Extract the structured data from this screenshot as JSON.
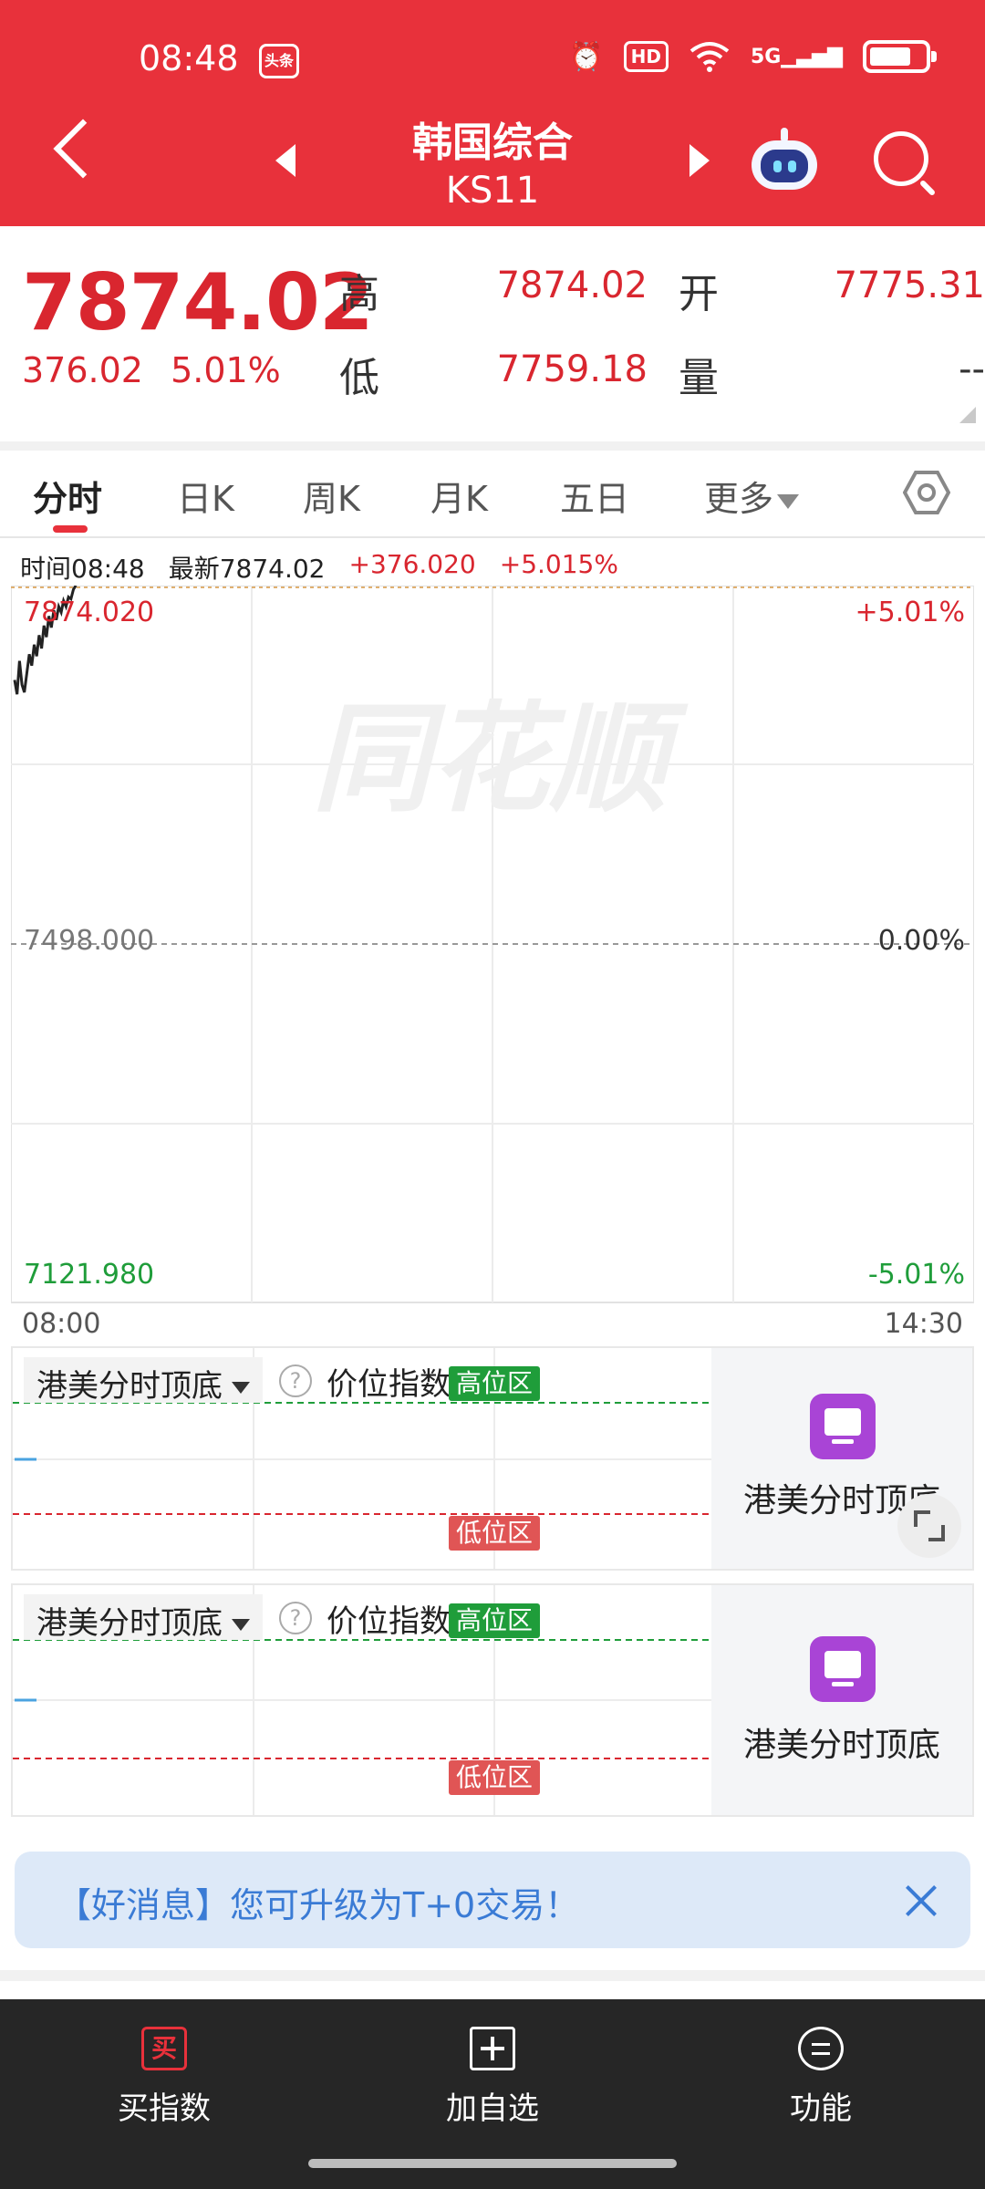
{
  "status_bar": {
    "time": "08:48",
    "badge": "头条",
    "hd": "HD",
    "network": "5G"
  },
  "nav": {
    "title": "韩国综合",
    "code": "KS11"
  },
  "quote": {
    "price": "7874.02",
    "change": "376.02",
    "change_pct": "5.01%",
    "high_label": "高",
    "high_value": "7874.02",
    "open_label": "开",
    "open_value": "7775.31",
    "low_label": "低",
    "low_value": "7759.18",
    "volume_label": "量",
    "volume_value": "--"
  },
  "tabs": [
    {
      "label": "分时"
    },
    {
      "label": "日K"
    },
    {
      "label": "周K"
    },
    {
      "label": "月K"
    },
    {
      "label": "五日"
    },
    {
      "label": "更多"
    }
  ],
  "info_line": {
    "time": "时间08:48",
    "latest": "最新7874.02",
    "change": "+376.020",
    "change_pct": "+5.015%"
  },
  "chart_data": {
    "type": "line",
    "y_top_label": "7874.020",
    "y_mid_label": "7498.000",
    "y_bottom_label": "7121.980",
    "pct_top_label": "+5.01%",
    "pct_mid_label": "0.00%",
    "pct_bottom_label": "-5.01%",
    "x_start_label": "08:00",
    "x_end_label": "14:30",
    "ylim": [
      7121.98,
      7874.02
    ],
    "watermark": "同花顺",
    "series": [
      {
        "x": [
          "08:00",
          "08:01",
          "08:02",
          "08:03",
          "08:04",
          "08:05",
          "08:06",
          "08:07",
          "08:08",
          "08:09",
          "08:10",
          "08:11",
          "08:12",
          "08:13",
          "08:14",
          "08:15",
          "08:16",
          "08:17",
          "08:18",
          "08:19",
          "08:20",
          "08:21",
          "08:22",
          "08:23",
          "08:24",
          "08:25"
        ],
        "values": [
          7775,
          7760,
          7795,
          7770,
          7762,
          7782,
          7802,
          7790,
          7812,
          7800,
          7822,
          7808,
          7832,
          7820,
          7842,
          7830,
          7848,
          7838,
          7852,
          7846,
          7858,
          7852,
          7862,
          7860,
          7870,
          7874
        ]
      }
    ]
  },
  "indicator_panels": [
    {
      "select_label": "港美分时顶底",
      "name": "价位指数",
      "high_zone": "高位区",
      "low_zone": "低位区",
      "side_label": "港美分时顶底"
    },
    {
      "select_label": "港美分时顶底",
      "name": "价位指数",
      "high_zone": "高位区",
      "low_zone": "低位区",
      "side_label": "港美分时顶底"
    }
  ],
  "banner": {
    "text": "【好消息】您可升级为T+0交易！"
  },
  "bottom_bar": {
    "buy_icon": "买",
    "buy_label": "买指数",
    "add_label": "加自选",
    "func_label": "功能"
  },
  "colors": {
    "header": "#e8313b",
    "up": "#d9262f",
    "down": "#1f9d3a",
    "accent_blue": "#3a7bd5"
  }
}
